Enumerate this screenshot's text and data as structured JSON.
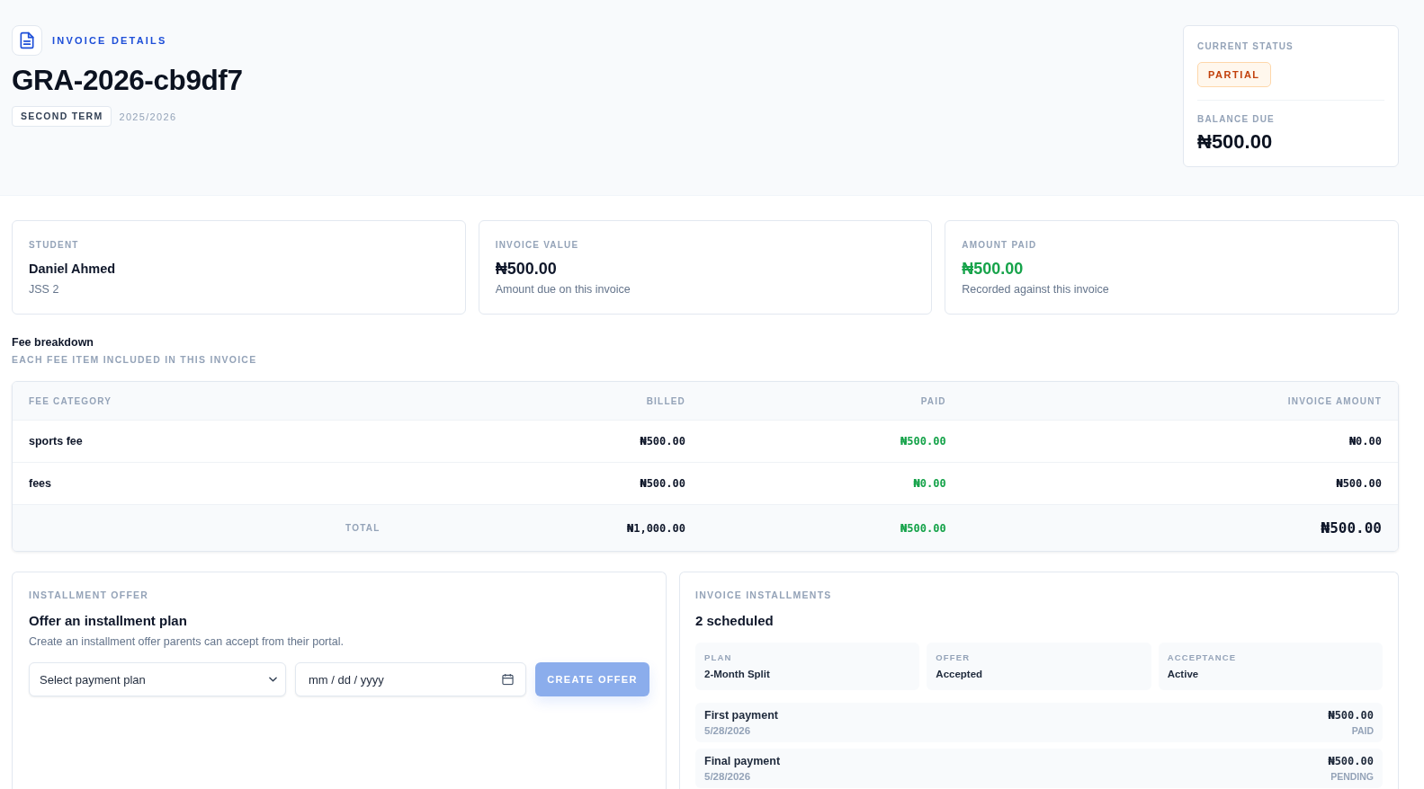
{
  "header": {
    "eyebrow": "INVOICE DETAILS",
    "invoice_number": "GRA-2026-cb9df7",
    "term": "SECOND TERM",
    "session": "2025/2026"
  },
  "status_card": {
    "status_label": "CURRENT STATUS",
    "status": "PARTIAL",
    "balance_label": "BALANCE DUE",
    "balance": "₦500.00"
  },
  "summary_cards": [
    {
      "kind": "name",
      "label": "STUDENT",
      "value": "Daniel Ahmed",
      "note": "JSS 2"
    },
    {
      "kind": "amount",
      "label": "INVOICE VALUE",
      "value": "₦500.00",
      "note": "Amount due on this invoice"
    },
    {
      "kind": "paid",
      "label": "AMOUNT PAID",
      "value": "₦500.00",
      "note": "Recorded against this invoice"
    }
  ],
  "fee_breakdown": {
    "title": "Fee breakdown",
    "subtitle": "EACH FEE ITEM INCLUDED IN THIS INVOICE",
    "columns": [
      "FEE CATEGORY",
      "BILLED",
      "PAID",
      "INVOICE AMOUNT"
    ],
    "rows": [
      {
        "category": "sports fee",
        "billed": "₦500.00",
        "paid": "₦500.00",
        "invoice_amount": "₦0.00"
      },
      {
        "category": "fees",
        "billed": "₦500.00",
        "paid": "₦0.00",
        "invoice_amount": "₦500.00"
      }
    ],
    "total": {
      "label": "TOTAL",
      "billed": "₦1,000.00",
      "paid": "₦500.00",
      "invoice_amount": "₦500.00"
    }
  },
  "installment_offer": {
    "eyebrow": "INSTALLMENT OFFER",
    "title": "Offer an installment plan",
    "description": "Create an installment offer parents can accept from their portal.",
    "plan_select": {
      "placeholder": "Select payment plan"
    },
    "date_field": {
      "placeholder": "mm / dd / yyyy"
    },
    "button": {
      "label": "CREATE OFFER",
      "disabled": true
    }
  },
  "invoice_installments": {
    "eyebrow": "INVOICE INSTALLMENTS",
    "title": "2 scheduled",
    "facts": [
      {
        "label": "PLAN",
        "value": "2-Month Split"
      },
      {
        "label": "OFFER",
        "value": "Accepted"
      },
      {
        "label": "ACCEPTANCE",
        "value": "Active"
      }
    ],
    "payments": [
      {
        "name": "First payment",
        "date": "5/28/2026",
        "amount": "₦500.00",
        "status": "PAID"
      },
      {
        "name": "Final payment",
        "date": "5/28/2026",
        "amount": "₦500.00",
        "status": "PENDING"
      }
    ]
  }
}
